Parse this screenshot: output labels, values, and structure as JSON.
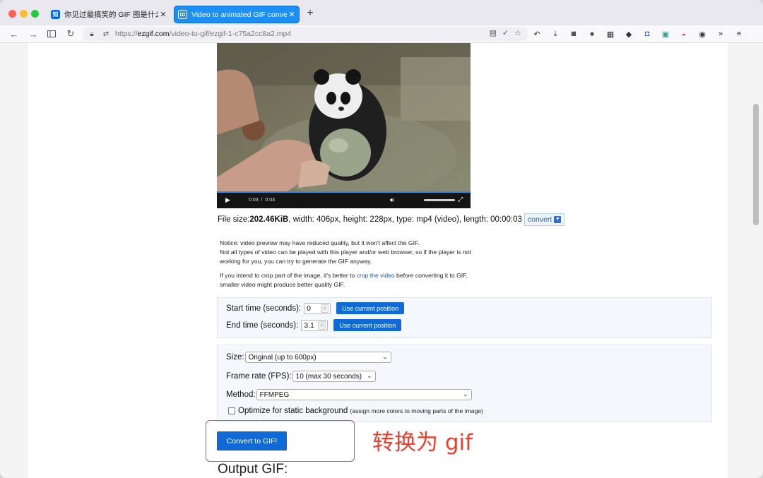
{
  "browser": {
    "tabs": [
      {
        "favicon": "知",
        "title": "你见过最搞笑的 GIF 图是什么? - 知",
        "active": false
      },
      {
        "favicon": "GIF",
        "title": "Video to animated GIF converter",
        "active": true
      }
    ],
    "url_prefix": "https://",
    "url_domain": "ezgif.com",
    "url_path": "/video-to-gif/ezgif-1-c75a2cc8a2.mp4"
  },
  "video": {
    "current_time": "0:03",
    "separator": "/",
    "duration": "0:03",
    "progress": 1.0
  },
  "file_info": {
    "label": "File size: ",
    "size": "202.46KiB",
    "details": ", width: 406px, height: 228px, type: mp4 (video), length: 00:00:03",
    "convert_label": "convert"
  },
  "notice": {
    "line1": "Notice: video preview may have reduced quality, but it won't affect the GIF.",
    "line2": "Not all types of video can be played with this player and/or web browser, so if the player is not",
    "line3": "working for you, you can try to generate the GIF anyway.",
    "crop_pre": "If you intend to crop part of the image, it's better to ",
    "crop_link": "crop the video",
    "crop_post": " before converting it to GIF,",
    "crop_line2": "smaller video might produce better quality GIF."
  },
  "time_panel": {
    "start_label": "Start time (seconds):",
    "start_value": "0",
    "end_label": "End time (seconds):",
    "end_value": "3.1",
    "use_position_label": "Use current position"
  },
  "options": {
    "size_label": "Size:",
    "size_value": "Original (up to 600px)",
    "fps_label": "Frame rate (FPS):",
    "fps_value": "10 (max 30 seconds)",
    "method_label": "Method:",
    "method_value": "FFMPEG",
    "optimize_label": "Optimize for static background",
    "optimize_hint": "(assign more colors to moving parts of the image)",
    "optimize_checked": false
  },
  "convert_button": "Convert to GIF!",
  "annotation": "转换为 gif",
  "output_heading": "Output GIF:",
  "colors": {
    "accent": "#1169d6",
    "tab_active": "#1c8ff5",
    "annotation": "#e8412f"
  }
}
